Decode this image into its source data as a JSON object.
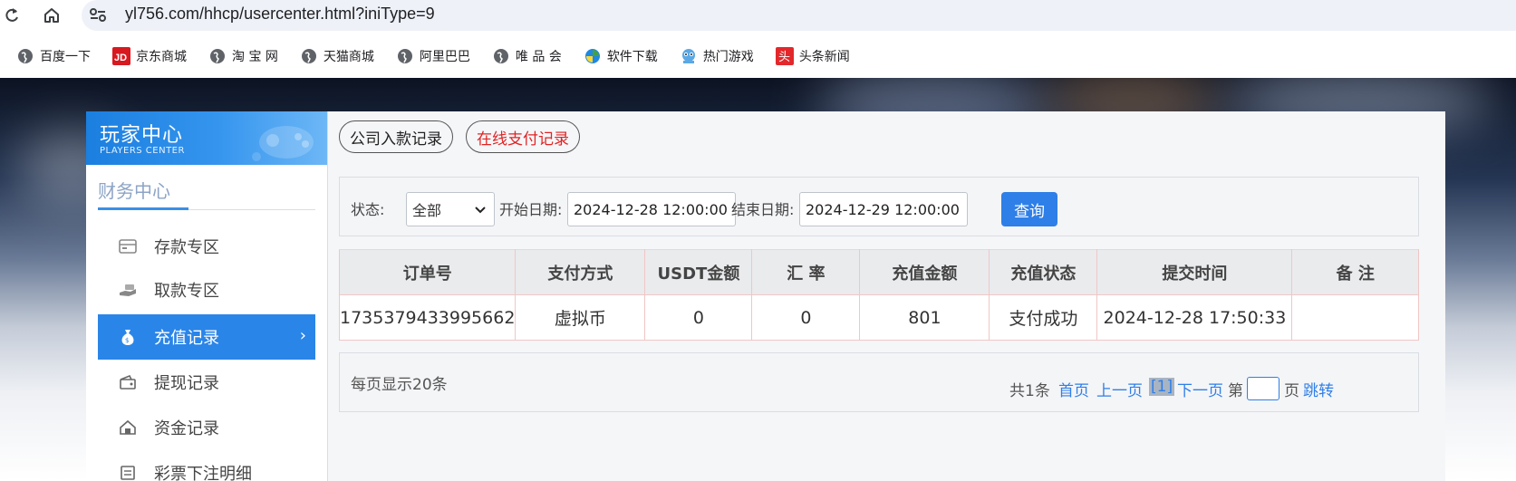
{
  "browser": {
    "url": "yl756.com/hhcp/usercenter.html?iniType=9",
    "bookmarks": [
      {
        "label": "百度一下",
        "icon": "globe-icon"
      },
      {
        "label": "京东商城",
        "icon": "jd-logo-icon"
      },
      {
        "label": "淘 宝 网",
        "icon": "globe-icon"
      },
      {
        "label": "天猫商城",
        "icon": "globe-icon"
      },
      {
        "label": "阿里巴巴",
        "icon": "globe-icon"
      },
      {
        "label": "唯 品 会",
        "icon": "globe-icon"
      },
      {
        "label": "软件下载",
        "icon": "software-icon"
      },
      {
        "label": "热门游戏",
        "icon": "game-icon"
      },
      {
        "label": "头条新闻",
        "icon": "toutiao-icon"
      }
    ]
  },
  "sidebar": {
    "header_title": "玩家中心",
    "header_subtitle": "PLAYERS CENTER",
    "section_title": "财务中心",
    "items": [
      {
        "label": "存款专区",
        "icon": "card-icon",
        "active": false
      },
      {
        "label": "取款专区",
        "icon": "withdraw-hand-icon",
        "active": false
      },
      {
        "label": "充值记录",
        "icon": "money-bag-icon",
        "active": true
      },
      {
        "label": "提现记录",
        "icon": "wallet-icon",
        "active": false
      },
      {
        "label": "资金记录",
        "icon": "house-icon",
        "active": false
      },
      {
        "label": "彩票下注明细",
        "icon": "list-icon",
        "active": false
      }
    ],
    "active_chevron": "›"
  },
  "tabs": [
    {
      "label": "公司入款记录"
    },
    {
      "label": "在线支付记录"
    }
  ],
  "filter": {
    "status_label": "状态:",
    "status_value": "全部",
    "start_label": "开始日期:",
    "start_value": "2024-12-28 12:00:00",
    "end_label": "结束日期:",
    "end_value": "2024-12-29 12:00:00",
    "query_label": "查询"
  },
  "table": {
    "headers": [
      "订单号",
      "支付方式",
      "USDT金额",
      "汇 率",
      "充值金额",
      "充值状态",
      "提交时间",
      "备 注"
    ],
    "rows": [
      [
        "1735379433995662",
        "虚拟币",
        "0",
        "0",
        "801",
        "支付成功",
        "2024-12-28 17:50:33",
        ""
      ]
    ]
  },
  "pager": {
    "per_page": "每页显示20条",
    "total": "共1条",
    "first": "首页",
    "prev": "上一页",
    "current": "[1]",
    "next": "下一页",
    "goto_prefix": "第",
    "goto_suffix": "页",
    "jump": "跳转"
  },
  "colors": {
    "accent": "#2a85e8",
    "tab_red": "#e02424",
    "link": "#2f7fe8"
  }
}
